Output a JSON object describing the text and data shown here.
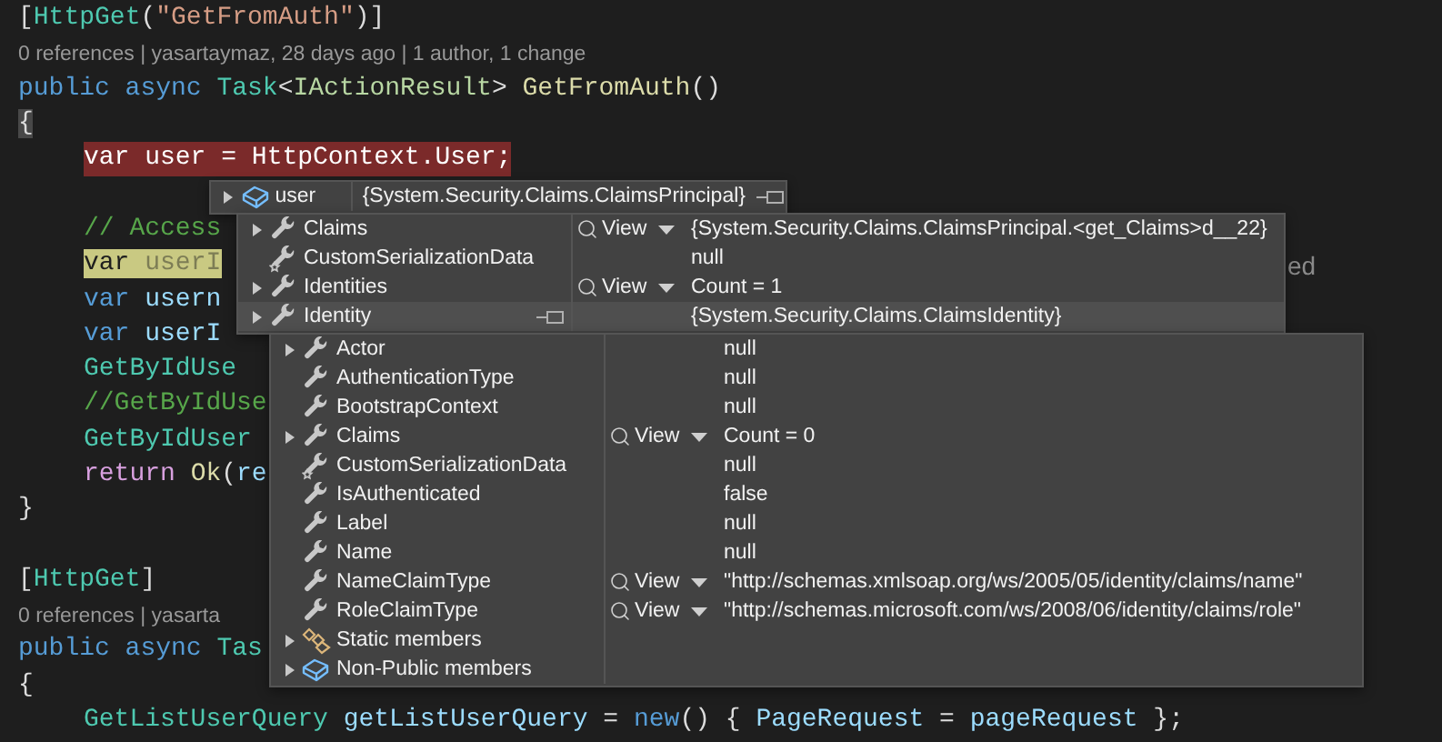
{
  "editor": {
    "lines": [
      {
        "kind": "code",
        "tokens": [
          {
            "text": "[",
            "kind": "punct"
          },
          {
            "text": "HttpGet",
            "kind": "type"
          },
          {
            "text": "(",
            "kind": "punct"
          },
          {
            "text": "\"GetFromAuth\"",
            "kind": "string"
          },
          {
            "text": ")]",
            "kind": "punct"
          }
        ]
      },
      {
        "kind": "codelens",
        "text": "0 references | yasartaymaz, 28 days ago | 1 author, 1 change"
      },
      {
        "kind": "code",
        "tokens": [
          {
            "text": "public async ",
            "kind": "keyword"
          },
          {
            "text": "Task",
            "kind": "type"
          },
          {
            "text": "<",
            "kind": "punct"
          },
          {
            "text": "IActionResult",
            "kind": "interface"
          },
          {
            "text": "> ",
            "kind": "punct"
          },
          {
            "text": "GetFromAuth",
            "kind": "method"
          },
          {
            "text": "()",
            "kind": "punct"
          }
        ]
      },
      {
        "kind": "code",
        "tokens": [
          {
            "text": "{",
            "kind": "brace-match"
          }
        ]
      },
      {
        "kind": "breakpoint",
        "tokens": [
          {
            "text": "var user = HttpContext.User;",
            "kind": "plain"
          }
        ]
      },
      {
        "kind": "blank"
      },
      {
        "kind": "body-code",
        "tokens": [
          {
            "text": "// Access",
            "kind": "comment"
          }
        ]
      },
      {
        "kind": "body-code",
        "tokens": [
          {
            "text": "var ",
            "kind": "hint-keyword"
          },
          {
            "text": "userI",
            "kind": "hint-ident"
          }
        ],
        "trailing_text": "ed"
      },
      {
        "kind": "body-code",
        "tokens": [
          {
            "text": "var ",
            "kind": "keyword"
          },
          {
            "text": "usern",
            "kind": "ident"
          }
        ]
      },
      {
        "kind": "body-code",
        "tokens": [
          {
            "text": "var ",
            "kind": "keyword"
          },
          {
            "text": "userI",
            "kind": "ident"
          }
        ]
      },
      {
        "kind": "body-code",
        "tokens": [
          {
            "text": "GetByIdUse",
            "kind": "type"
          }
        ]
      },
      {
        "kind": "body-code",
        "tokens": [
          {
            "text": "//GetByIdUse",
            "kind": "comment"
          }
        ]
      },
      {
        "kind": "body-code",
        "tokens": [
          {
            "text": "GetByIdUser",
            "kind": "type"
          }
        ]
      },
      {
        "kind": "body-code",
        "tokens": [
          {
            "text": "return ",
            "kind": "control"
          },
          {
            "text": "Ok",
            "kind": "method"
          },
          {
            "text": "(",
            "kind": "punct"
          },
          {
            "text": "re",
            "kind": "ident"
          }
        ]
      },
      {
        "kind": "code",
        "tokens": [
          {
            "text": "}",
            "kind": "punct"
          }
        ]
      },
      {
        "kind": "blank"
      },
      {
        "kind": "code",
        "tokens": [
          {
            "text": "[",
            "kind": "punct"
          },
          {
            "text": "HttpGet",
            "kind": "type"
          },
          {
            "text": "]",
            "kind": "punct"
          }
        ]
      },
      {
        "kind": "codelens",
        "text": "0 references | yasarta"
      },
      {
        "kind": "code",
        "tokens": [
          {
            "text": "public async ",
            "kind": "keyword"
          },
          {
            "text": "Tas",
            "kind": "type"
          }
        ]
      },
      {
        "kind": "code",
        "tokens": [
          {
            "text": "{",
            "kind": "punct"
          }
        ]
      },
      {
        "kind": "body-code",
        "tokens": [
          {
            "text": "GetListUserQuery",
            "kind": "type"
          },
          {
            "text": " getListUserQuery ",
            "kind": "ident"
          },
          {
            "text": "= ",
            "kind": "punct"
          },
          {
            "text": "new",
            "kind": "keyword"
          },
          {
            "text": "() { ",
            "kind": "punct"
          },
          {
            "text": "PageRequest",
            "kind": "ident"
          },
          {
            "text": " = ",
            "kind": "punct"
          },
          {
            "text": "pageRequest",
            "kind": "ident"
          },
          {
            "text": " };",
            "kind": "punct"
          }
        ]
      }
    ]
  },
  "datatip": {
    "name": "user",
    "value": "{System.Security.Claims.ClaimsPrincipal}",
    "kind": "object",
    "expandable": true,
    "pin": true,
    "selected": false,
    "children": [
      {
        "name": "Claims",
        "kind": "property",
        "expandable": true,
        "pin": false,
        "selected": false,
        "view": "View",
        "value": "{System.Security.Claims.ClaimsPrincipal.<get_Claims>d__22}"
      },
      {
        "name": "CustomSerializationData",
        "kind": "static-property",
        "expandable": false,
        "pin": false,
        "selected": false,
        "value": "null"
      },
      {
        "name": "Identities",
        "kind": "property",
        "expandable": true,
        "pin": false,
        "selected": false,
        "view": "View",
        "value": "Count = 1"
      },
      {
        "name": "Identity",
        "kind": "property",
        "expandable": true,
        "pin": true,
        "selected": true,
        "value": "{System.Security.Claims.ClaimsIdentity}",
        "children": [
          {
            "name": "Actor",
            "kind": "property",
            "expandable": true,
            "pin": false,
            "selected": false,
            "value": "null"
          },
          {
            "name": "AuthenticationType",
            "kind": "property",
            "expandable": false,
            "pin": false,
            "selected": false,
            "value": "null"
          },
          {
            "name": "BootstrapContext",
            "kind": "property",
            "expandable": false,
            "pin": false,
            "selected": false,
            "value": "null"
          },
          {
            "name": "Claims",
            "kind": "property",
            "expandable": true,
            "pin": false,
            "selected": false,
            "view": "View",
            "value": "Count = 0"
          },
          {
            "name": "CustomSerializationData",
            "kind": "static-property",
            "expandable": false,
            "pin": false,
            "selected": false,
            "value": "null"
          },
          {
            "name": "IsAuthenticated",
            "kind": "property",
            "expandable": false,
            "pin": false,
            "selected": false,
            "value": "false"
          },
          {
            "name": "Label",
            "kind": "property",
            "expandable": false,
            "pin": false,
            "selected": false,
            "value": "null"
          },
          {
            "name": "Name",
            "kind": "property",
            "expandable": false,
            "pin": false,
            "selected": false,
            "value": "null"
          },
          {
            "name": "NameClaimType",
            "kind": "property",
            "expandable": false,
            "pin": false,
            "selected": false,
            "view": "View",
            "value": "\"http://schemas.xmlsoap.org/ws/2005/05/identity/claims/name\""
          },
          {
            "name": "RoleClaimType",
            "kind": "property",
            "expandable": false,
            "pin": false,
            "selected": false,
            "view": "View",
            "value": "\"http://schemas.microsoft.com/ws/2008/06/identity/claims/role\""
          },
          {
            "name": "Static members",
            "kind": "static-members",
            "expandable": true,
            "pin": false,
            "selected": false
          },
          {
            "name": "Non-Public members",
            "kind": "object",
            "expandable": true,
            "pin": false,
            "selected": false
          }
        ]
      }
    ]
  }
}
